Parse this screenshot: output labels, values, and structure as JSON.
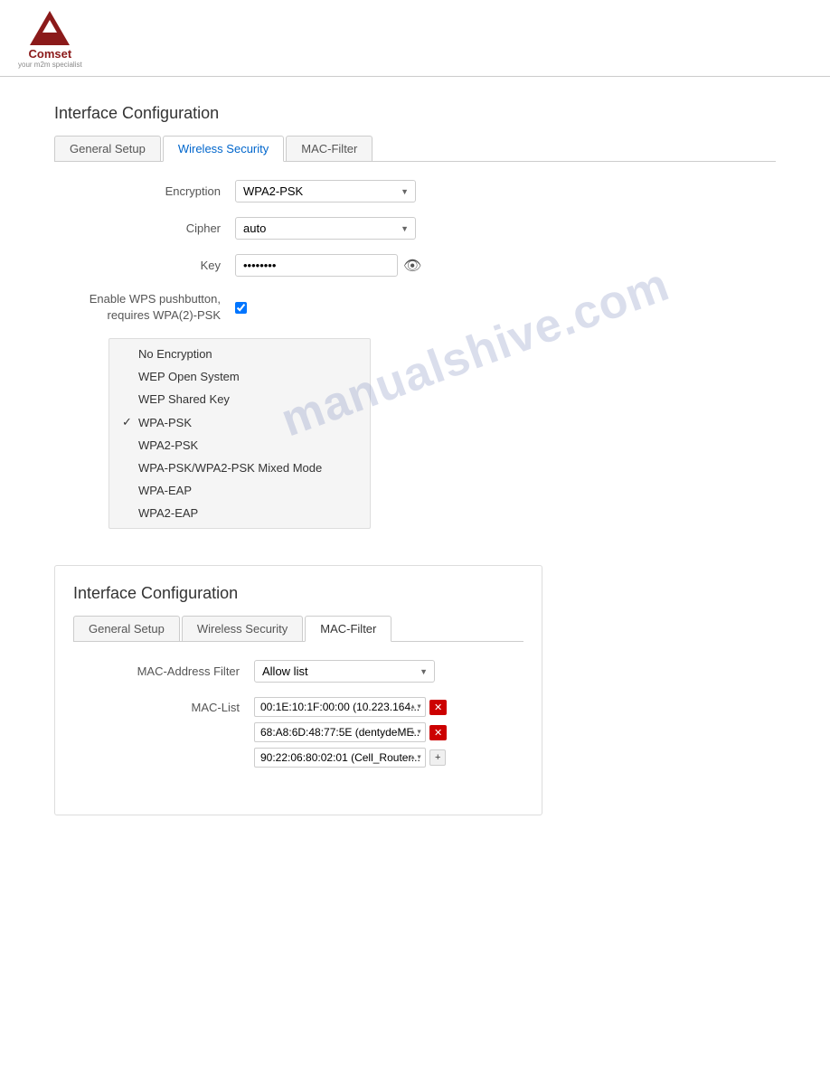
{
  "header": {
    "logo_text": "Comset",
    "logo_subtext": "your m2m specialist"
  },
  "section1": {
    "title": "Interface Configuration",
    "tabs": [
      {
        "label": "General Setup",
        "active": false
      },
      {
        "label": "Wireless Security",
        "active": true
      },
      {
        "label": "MAC-Filter",
        "active": false
      }
    ],
    "encryption_label": "Encryption",
    "encryption_value": "WPA2-PSK",
    "cipher_label": "Cipher",
    "cipher_value": "auto",
    "key_label": "Key",
    "key_value": "••••••••",
    "wps_label_line1": "Enable WPS pushbutton,",
    "wps_label_line2": "requires WPA(2)-PSK"
  },
  "dropdown_menu": {
    "items": [
      {
        "label": "No Encryption",
        "selected": false
      },
      {
        "label": "WEP Open System",
        "selected": false
      },
      {
        "label": "WEP Shared Key",
        "selected": false
      },
      {
        "label": "WPA-PSK",
        "selected": true
      },
      {
        "label": "WPA2-PSK",
        "selected": false
      },
      {
        "label": "WPA-PSK/WPA2-PSK Mixed Mode",
        "selected": false
      },
      {
        "label": "WPA-EAP",
        "selected": false
      },
      {
        "label": "WPA2-EAP",
        "selected": false
      }
    ]
  },
  "section2": {
    "title": "Interface Configuration",
    "tabs": [
      {
        "label": "General Setup",
        "active": false
      },
      {
        "label": "Wireless Security",
        "active": false
      },
      {
        "label": "MAC-Filter",
        "active": true
      }
    ],
    "mac_filter_label": "MAC-Address Filter",
    "mac_filter_value": "Allow list",
    "mac_list_label": "MAC-List",
    "mac_entries": [
      {
        "value": "00:1E:10:1F:00:00 (10.223.164..."
      },
      {
        "value": "68:A8:6D:48:77:5E (dentydeME..."
      },
      {
        "value": "90:22:06:80:02:01 (Cell_Router..."
      }
    ]
  },
  "watermark": {
    "text": "manualshive.com"
  }
}
